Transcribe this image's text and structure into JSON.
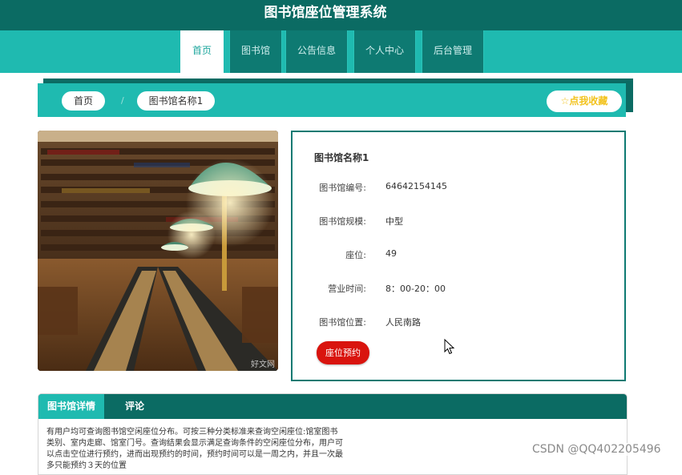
{
  "header": {
    "title": "图书馆座位管理系统"
  },
  "nav": {
    "items": [
      {
        "label": "首页",
        "active": true
      },
      {
        "label": "图书馆"
      },
      {
        "label": "公告信息"
      },
      {
        "label": "个人中心"
      },
      {
        "label": "后台管理"
      }
    ]
  },
  "breadcrumb": {
    "home": "首页",
    "separator": "/",
    "current": "图书馆名称1"
  },
  "favorite": {
    "icon": "☆",
    "label": "点我收藏"
  },
  "photo": {
    "watermark": "好文网"
  },
  "info": {
    "title": "图书馆名称1",
    "rows": [
      {
        "label": "图书馆编号:",
        "value": "64642154145"
      },
      {
        "label": "图书馆规模:",
        "value": "中型"
      },
      {
        "label": "座位:",
        "value": "49"
      },
      {
        "label": "营业时间:",
        "value": "8：00-20：00"
      },
      {
        "label": "图书馆位置:",
        "value": "人民南路"
      }
    ],
    "reserve_label": "座位预约"
  },
  "tabs": {
    "items": [
      {
        "label": "图书馆详情"
      },
      {
        "label": "评论"
      }
    ],
    "detail_text": "有用户均可查询图书馆空闲座位分布。可按三种分类标准来查询空闲座位:馆室图书类别、室内走廊、馆室门号。查询结果会显示满足查询条件的空闲座位分布，用户可以点击空位进行预约，进而出现预约的时间，预约时间可以是一周之内，并且一次最多只能预约３天的位置"
  },
  "watermark": "CSDN @QQ402205496",
  "colors": {
    "dark_teal": "#0b6b63",
    "teal": "#1fbab0",
    "red": "#d9140e",
    "gold": "#f2c21b"
  }
}
